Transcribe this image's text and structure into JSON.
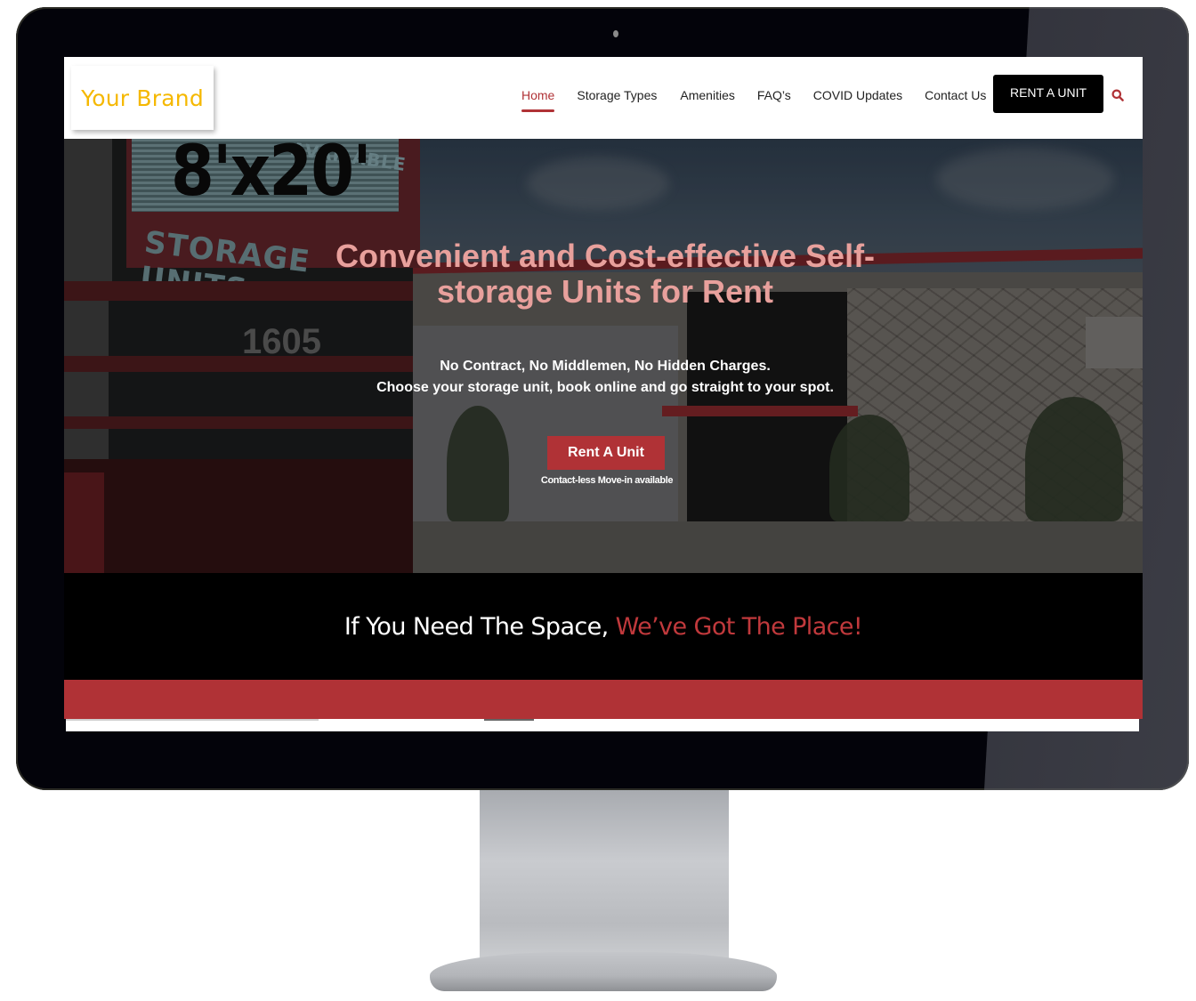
{
  "device": {
    "type": "desktop-monitor-mockup",
    "camera_icon": "camera-dot"
  },
  "header": {
    "logo": "Your Brand",
    "nav": [
      {
        "label": "Home",
        "active": true
      },
      {
        "label": "Storage Types",
        "active": false
      },
      {
        "label": "Amenities",
        "active": false
      },
      {
        "label": "FAQ’s",
        "active": false
      },
      {
        "label": "COVID Updates",
        "active": false
      },
      {
        "label": "Contact Us",
        "active": false
      }
    ],
    "cta_label": "RENT A UNIT",
    "search_icon": "search-icon"
  },
  "hero": {
    "sign_text": {
      "available": "AVAILABLE",
      "size": "8'x20'",
      "storage": "STORAGE UNITS",
      "address_number": "1605"
    },
    "title": "Convenient and Cost-effective Self-storage Units for Rent",
    "subtitle_line1": "No Contract, No Middlemen, No Hidden Charges.",
    "subtitle_line2": "Choose your storage unit, book online and go straight to your spot.",
    "cta_label": "Rent A Unit",
    "cta_note": "Contact-less Move-in available"
  },
  "tagline": {
    "part1": "If You Need The Space, ",
    "part2": "We’ve Got The Place!"
  },
  "colors": {
    "brand_red": "#b03236",
    "logo_yellow": "#f5b800",
    "hero_title_pink": "#e8a09c",
    "nav_text": "#222222",
    "black": "#000000"
  }
}
